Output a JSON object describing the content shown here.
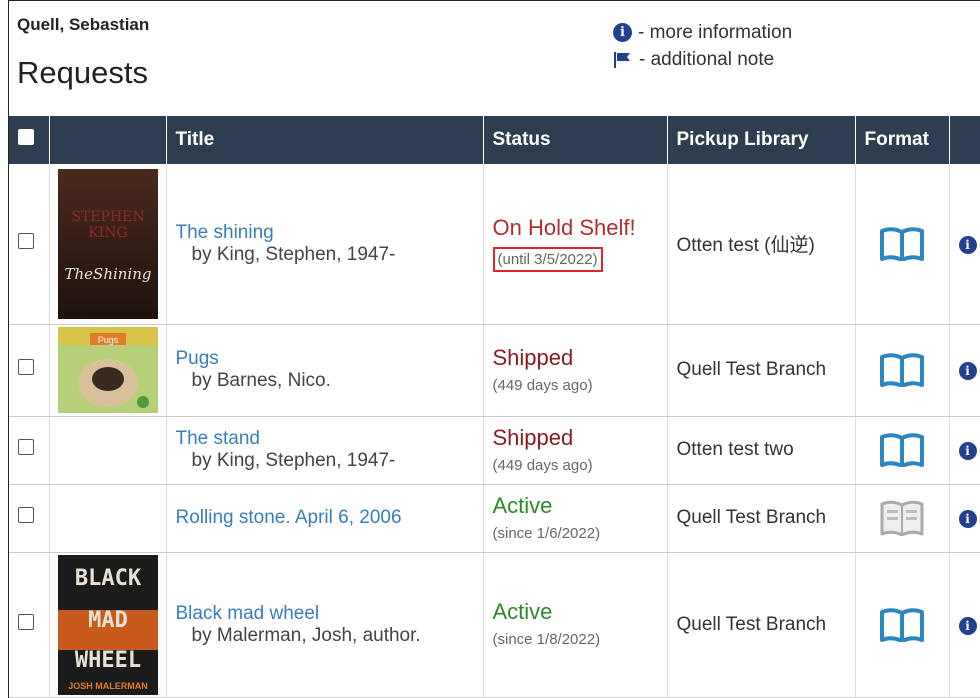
{
  "patron": {
    "name": "Quell, Sebastian"
  },
  "page": {
    "title": "Requests"
  },
  "legend": {
    "info_text": "- more information",
    "note_text": "- additional note",
    "info_glyph": "i"
  },
  "table": {
    "headers": {
      "title": "Title",
      "status": "Status",
      "pickup": "Pickup Library",
      "format": "Format"
    },
    "rows": [
      {
        "title": "The shining",
        "author": "by King, Stephen, 1947-",
        "status": "On Hold Shelf!",
        "status_sub": "(until 3/5/2022)",
        "status_kind": "hold",
        "pickup": "Otten test (仙逆)",
        "format_icon": "book-icon",
        "cover": "cover-the-shining"
      },
      {
        "title": "Pugs",
        "author": "by Barnes, Nico.",
        "status": "Shipped",
        "status_sub": "(449 days ago)",
        "status_kind": "shipped",
        "pickup": "Quell Test Branch",
        "format_icon": "book-icon",
        "cover": "cover-pugs"
      },
      {
        "title": "The stand",
        "author": "by King, Stephen, 1947-",
        "status": "Shipped",
        "status_sub": "(449 days ago)",
        "status_kind": "shipped",
        "pickup": "Otten test two",
        "format_icon": "book-icon",
        "cover": ""
      },
      {
        "title": "Rolling stone. April 6, 2006",
        "author": "",
        "status": "Active",
        "status_sub": "(since 1/6/2022)",
        "status_kind": "active",
        "pickup": "Quell Test Branch",
        "format_icon": "magazine-icon",
        "cover": ""
      },
      {
        "title": "Black mad wheel",
        "author": "by Malerman, Josh, author.",
        "status": "Active",
        "status_sub": "(since 1/8/2022)",
        "status_kind": "active",
        "pickup": "Quell Test Branch",
        "format_icon": "book-icon",
        "cover": "cover-black-mad-wheel"
      }
    ]
  },
  "covers": {
    "shining_text_1": "STEPHEN",
    "shining_text_2": "KING",
    "shining_text_3": "TheShining",
    "pugs_text": "Pugs",
    "bmw_text_1": "BLACK",
    "bmw_text_2": "MAD",
    "bmw_text_3": "WHEEL",
    "bmw_text_4": "JOSH MALERMAN"
  },
  "colors": {
    "header_bg": "#2c3e50",
    "link": "#3a7dbd",
    "hold": "#b32d2d",
    "shipped": "#8b1a1a",
    "active": "#2b8a2b",
    "highlight": "#e0262b",
    "book_icon": "#2e86c1"
  }
}
